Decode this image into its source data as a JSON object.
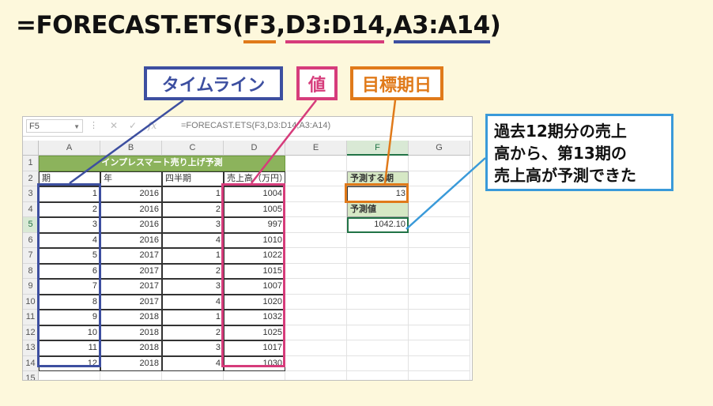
{
  "formula": {
    "prefix": "=FORECAST.ETS(",
    "arg1": "F3",
    "sep1": ",",
    "arg2": "D3:D14",
    "sep2": ",",
    "arg3": "A3:A14",
    "suffix": ")"
  },
  "labels": {
    "timeline": "タイムライン",
    "value": "値",
    "target_date": "目標期日"
  },
  "callout": {
    "line1": "過去12期分の売上",
    "line2": "高から、第13期の",
    "line3": "売上高が予測できた"
  },
  "excel": {
    "name_box": "F5",
    "formula_text": "=FORECAST.ETS(F3,D3:D14,A3:A14)",
    "columns": [
      "A",
      "B",
      "C",
      "D",
      "E",
      "F",
      "G"
    ],
    "rows": [
      "1",
      "2",
      "3",
      "4",
      "5",
      "6",
      "7",
      "8",
      "9",
      "10",
      "11",
      "12",
      "13",
      "14",
      "15"
    ],
    "title": "インプレスマート売り上げ予測",
    "headers": {
      "a": "期",
      "b": "年",
      "c": "四半期",
      "d": "売上高（万円）"
    },
    "data": [
      {
        "a": "1",
        "b": "2016",
        "c": "1",
        "d": "1004"
      },
      {
        "a": "2",
        "b": "2016",
        "c": "2",
        "d": "1005"
      },
      {
        "a": "3",
        "b": "2016",
        "c": "3",
        "d": "997"
      },
      {
        "a": "4",
        "b": "2016",
        "c": "4",
        "d": "1010"
      },
      {
        "a": "5",
        "b": "2017",
        "c": "1",
        "d": "1022"
      },
      {
        "a": "6",
        "b": "2017",
        "c": "2",
        "d": "1015"
      },
      {
        "a": "7",
        "b": "2017",
        "c": "3",
        "d": "1007"
      },
      {
        "a": "8",
        "b": "2017",
        "c": "4",
        "d": "1020"
      },
      {
        "a": "9",
        "b": "2018",
        "c": "1",
        "d": "1032"
      },
      {
        "a": "10",
        "b": "2018",
        "c": "2",
        "d": "1025"
      },
      {
        "a": "11",
        "b": "2018",
        "c": "3",
        "d": "1017"
      },
      {
        "a": "12",
        "b": "2018",
        "c": "4",
        "d": "1030"
      }
    ],
    "forecast_period_label": "予測する期",
    "forecast_period_value": "13",
    "forecast_value_label": "予測値",
    "forecast_value": "1042.10"
  },
  "colors": {
    "orange": "#e07a1a",
    "pink": "#d63c7b",
    "blue": "#3d4fa0",
    "callout": "#3a9ad9",
    "excel_green": "#217346",
    "title_green": "#8cb35c",
    "background": "#fdf8dc"
  }
}
